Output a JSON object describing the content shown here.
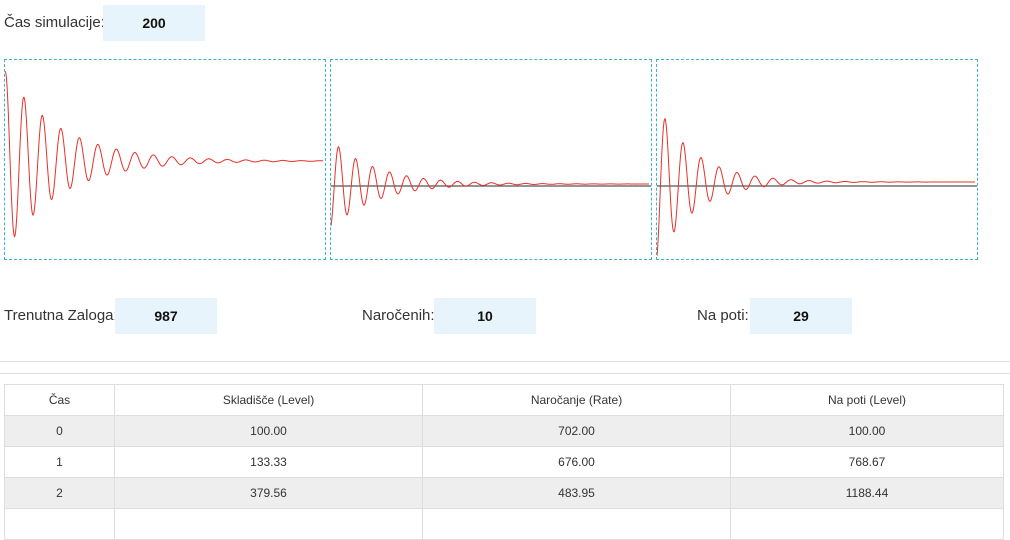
{
  "simulation": {
    "label": "Čas simulacije:",
    "value": "200"
  },
  "stats": {
    "stock": {
      "label": "Trenutna Zaloga:",
      "value": "987"
    },
    "ordered": {
      "label": "Naročenih:",
      "value": "10"
    },
    "in_transit": {
      "label": "Na poti:",
      "value": "29"
    }
  },
  "table": {
    "headers": [
      "Čas",
      "Skladišče (Level)",
      "Naročanje (Rate)",
      "Na poti (Level)"
    ],
    "rows": [
      [
        "0",
        "100.00",
        "702.00",
        "100.00"
      ],
      [
        "1",
        "133.33",
        "676.00",
        "768.67"
      ],
      [
        "2",
        "379.56",
        "483.95",
        "1188.44"
      ],
      [
        "",
        "",
        "",
        ""
      ]
    ]
  },
  "colors": {
    "signal": "#e8302a",
    "reference": "#555555",
    "panel_border": "#39b5c8",
    "value_box": "#e8f4fb"
  }
}
